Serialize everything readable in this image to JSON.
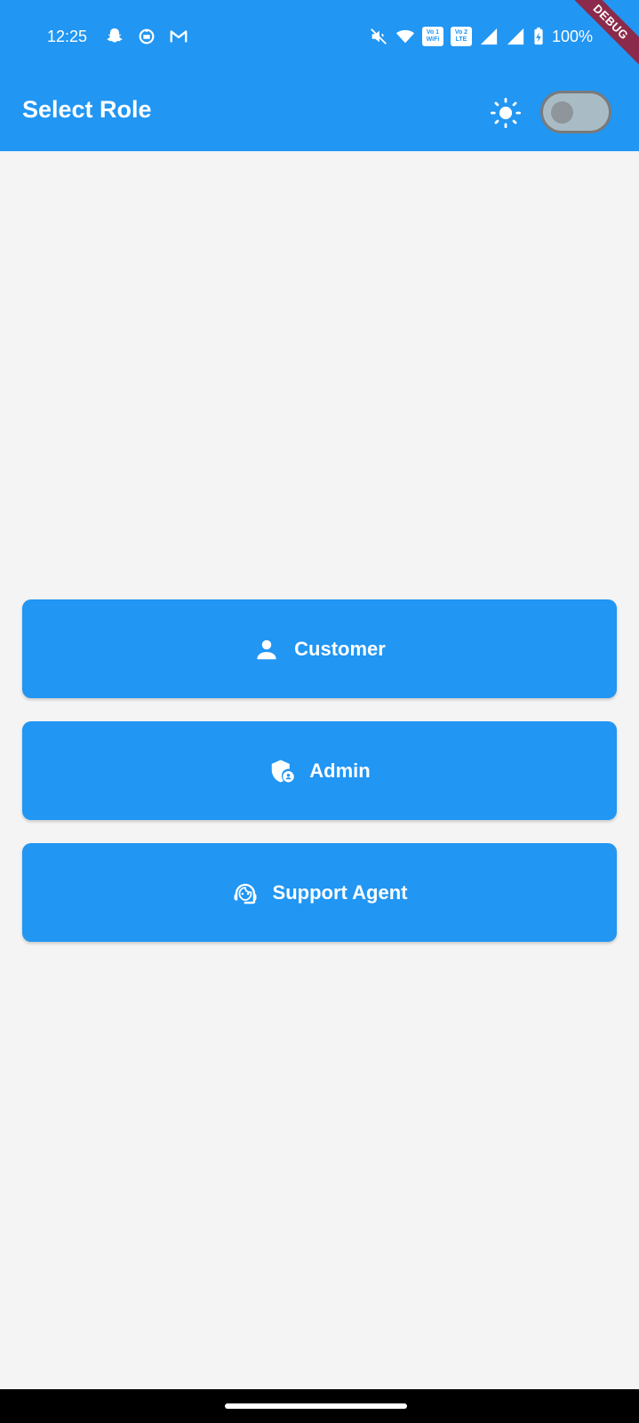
{
  "status_bar": {
    "time": "12:25",
    "left_icons": [
      "snapchat-icon",
      "app-icon",
      "gmail-icon"
    ],
    "right_icons": [
      "mute-icon",
      "wifi-icon",
      "volte-wifi-icon",
      "volte-lte-icon",
      "signal-icon",
      "signal-icon",
      "battery-charging-icon"
    ],
    "volte1_top": "Vo 1",
    "volte1_bottom": "WiFi",
    "volte2_top": "Vo 2",
    "volte2_bottom": "LTE",
    "battery": "100%"
  },
  "debug_banner": "DEBUG",
  "app_bar": {
    "title": "Select Role",
    "theme_icon": "sun-icon",
    "dark_mode_enabled": false
  },
  "roles": [
    {
      "label": "Customer",
      "icon": "person-icon"
    },
    {
      "label": "Admin",
      "icon": "admin-shield-icon"
    },
    {
      "label": "Support Agent",
      "icon": "support-agent-icon"
    }
  ],
  "colors": {
    "primary": "#2196f3",
    "background": "#f4f4f4",
    "debug_ribbon": "#8b2a4a"
  }
}
